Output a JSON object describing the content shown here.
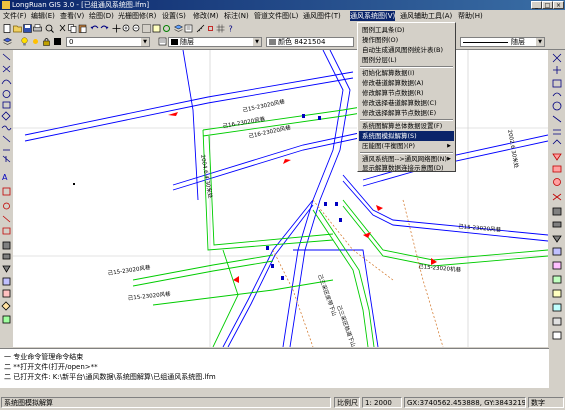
{
  "window": {
    "title": "LongRuan GIS 3.0 - [已组通风系统图.lfm]"
  },
  "menu": [
    {
      "label": "文件(F)"
    },
    {
      "label": "编辑(E)"
    },
    {
      "label": "查看(V)"
    },
    {
      "label": "绘图(D)"
    },
    {
      "label": "光栅图修(R)"
    },
    {
      "label": "设置(S)"
    },
    {
      "label": "修改(M)"
    },
    {
      "label": "标注(N)"
    },
    {
      "label": "管道文件图(L)"
    },
    {
      "label": "通风图件(T)"
    },
    {
      "label": "通风系统图(V)"
    },
    {
      "label": "通风辅助工具(A)"
    },
    {
      "label": "帮助(H)"
    }
  ],
  "toolbar": {
    "layer_combo": "0",
    "linetype_combo": "随层",
    "color_label": "颜色 8421504",
    "right_combo": "随层"
  },
  "dropdown": {
    "items": [
      "图例工具条(D)",
      "操作图例(O)",
      "自动生成通风图例统计表(B)",
      "图例分层(L)",
      "初始化解算数据(I)",
      "修改巷道解算数据(A)",
      "修改解算节点数据(R)",
      "修改选择巷道解算数据(C)",
      "修改选择解算节点数据(E)",
      "系统图解算总体数据设置(F)",
      "系统图模拟解算(S)",
      "压能图(平衡图)(P)",
      "通风系统图-->通风网络图(N)",
      "显示解算数据连接示意图(D)"
    ]
  },
  "map": {
    "labels": [
      "己15-23020风巷",
      "己16-23020风巷",
      "己16-23020风巷",
      "2004.6.4 30米处",
      "己15-23020风巷",
      "己15-23020风巷",
      "己15-23020风巷",
      "己15-23020机巷",
      "己三采区皮带下山",
      "己三采区轨道下山",
      "2002.6 30米处"
    ]
  },
  "command": {
    "lines": [
      "一 专业命令管理命令结束",
      "二 **打开文件(打开/open>**",
      "二 已打开文件: K:\\新平台\\通风数据\\系统图解算\\已组通风系统图.lfm"
    ]
  },
  "status": {
    "left": "系统图模拟解算",
    "scale_label": "比例尺",
    "scale_value": "1: 2000",
    "coords": "GX:3740562.453888, GY:38432194.835",
    "mode": "数字"
  },
  "colors": {
    "titlebar": "#0a246a",
    "airway_blue": "#0000ff",
    "airway_green": "#00cc00",
    "arrow_red": "#ff0000",
    "gridline": "#c0c0c0"
  }
}
